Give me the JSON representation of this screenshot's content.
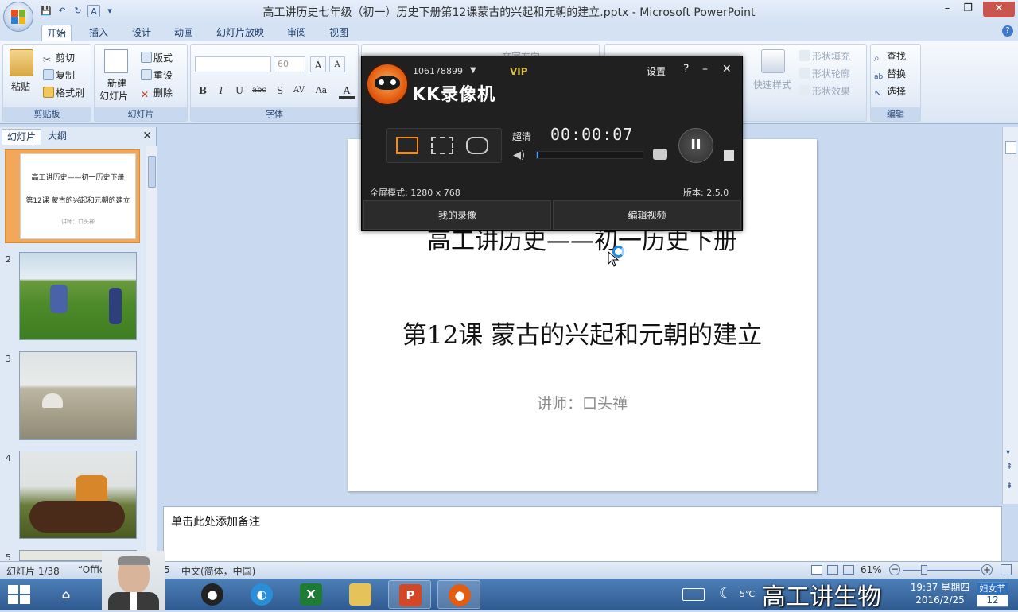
{
  "window": {
    "title": "高工讲历史七年级（初一）历史下册第12课蒙古的兴起和元朝的建立.pptx - Microsoft PowerPoint",
    "min": "–",
    "max": "❐",
    "close": "✕"
  },
  "qat": {
    "save": "💾",
    "undo": "↶",
    "redo": "↻",
    "font": "A",
    "more": "▾"
  },
  "tabs": [
    "开始",
    "插入",
    "设计",
    "动画",
    "幻灯片放映",
    "审阅",
    "视图"
  ],
  "ribbon": {
    "clipboard": {
      "label": "剪贴板",
      "paste": "粘贴",
      "cut": "剪切",
      "copy": "复制",
      "format_painter": "格式刷"
    },
    "slides": {
      "label": "幻灯片",
      "new_slide": "新建",
      "new_slide2": "幻灯片",
      "layout": "版式",
      "reset": "重设",
      "delete": "删除"
    },
    "font": {
      "label": "字体",
      "size": "60",
      "bold": "B",
      "italic": "I",
      "underline": "U",
      "strike": "abc",
      "shadow": "S",
      "spacing": "AV",
      "case": "Aa"
    },
    "paragraph": {
      "text_direction": "文字方向"
    },
    "drawing": {
      "quick_styles": "快速样式",
      "shape_fill": "形状填充",
      "shape_outline": "形状轮廓",
      "shape_effects": "形状效果"
    },
    "editing": {
      "label": "编辑",
      "find": "查找",
      "replace": "替换",
      "select": "选择"
    }
  },
  "left_panel": {
    "tab_slides": "幻灯片",
    "tab_outline": "大纲",
    "close": "✕",
    "thumbs": [
      {
        "num": "1",
        "line1": "高工讲历史——初一历史下册",
        "line2": "第12课 蒙古的兴起和元朝的建立",
        "line3": "讲师：口头禅"
      },
      {
        "num": "2"
      },
      {
        "num": "3"
      },
      {
        "num": "4"
      },
      {
        "num": "5"
      }
    ]
  },
  "slide": {
    "line1": "高工讲历史——初一历史下册",
    "line2": "第12课 蒙古的兴起和元朝的建立",
    "line3": "讲师：口头禅"
  },
  "notes": {
    "placeholder": "单击此处添加备注"
  },
  "status": {
    "slide": "幻灯片 1/38",
    "theme": "“Offic",
    "theme_tail": "5",
    "lang": "中文(简体，中国)",
    "zoom": "61%"
  },
  "recorder": {
    "account": "106178899",
    "vip": "VIP",
    "brand": "KK录像机",
    "settings": "设置",
    "help": "?",
    "minimize": "–",
    "close": "✕",
    "quality": "超清",
    "timer": "00:00:07",
    "mode_info": "全屏模式: 1280 x 768",
    "version": "版本: 2.5.0",
    "my_recordings": "我的录像",
    "edit_video": "编辑视频",
    "volume_level": 0.0
  },
  "taskbar": {
    "temp": "5℃",
    "time": "19:37",
    "weekday": "星期四",
    "date": "2016/2/25",
    "holiday": "妇女节",
    "day": "12",
    "watermark": "高工讲生物"
  }
}
